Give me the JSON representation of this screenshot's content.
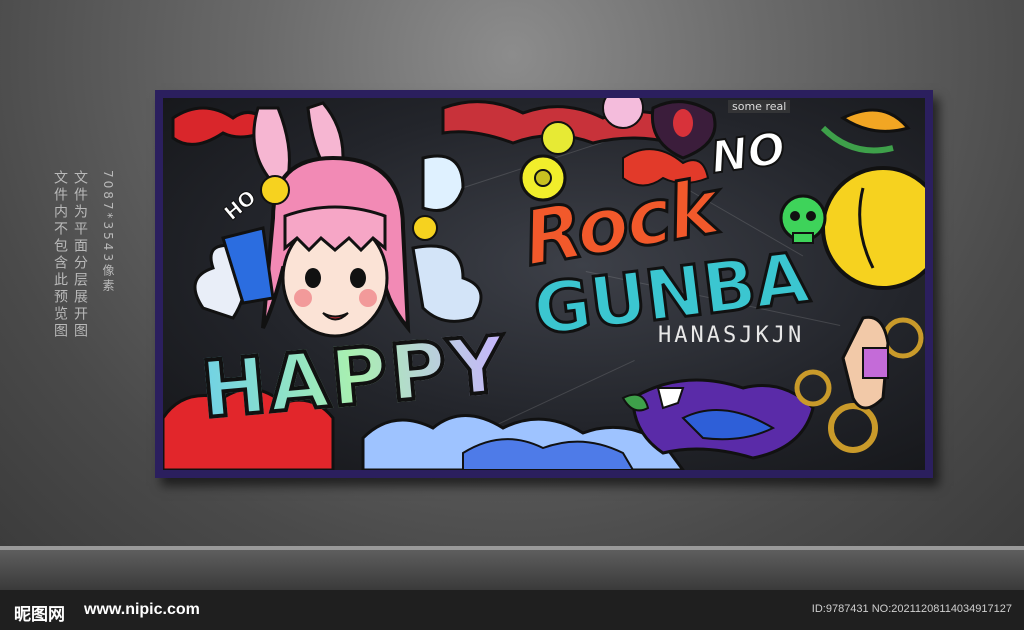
{
  "side_note": {
    "col1": "文件为平面分层展开图",
    "col2": "文件内不包含此预览图",
    "col3": "7087*3543像素"
  },
  "poster": {
    "no": "NO",
    "rock": "Rock",
    "gunba": "GUNBA",
    "happy": "HAPPY",
    "subtitle": "HANASJKJN",
    "some_real": "some real",
    "hoy": "HO"
  },
  "watermark": {
    "logo": "昵图网",
    "site": "www.nipic.com",
    "id": "ID:9787431 NO:20211208114034917127"
  },
  "colors": {
    "frame": "#2b1f5e",
    "rock": "#f2592b",
    "gunba": "#3bc6d0",
    "hair": "#f28ab5",
    "skull": "#3ed35a"
  }
}
